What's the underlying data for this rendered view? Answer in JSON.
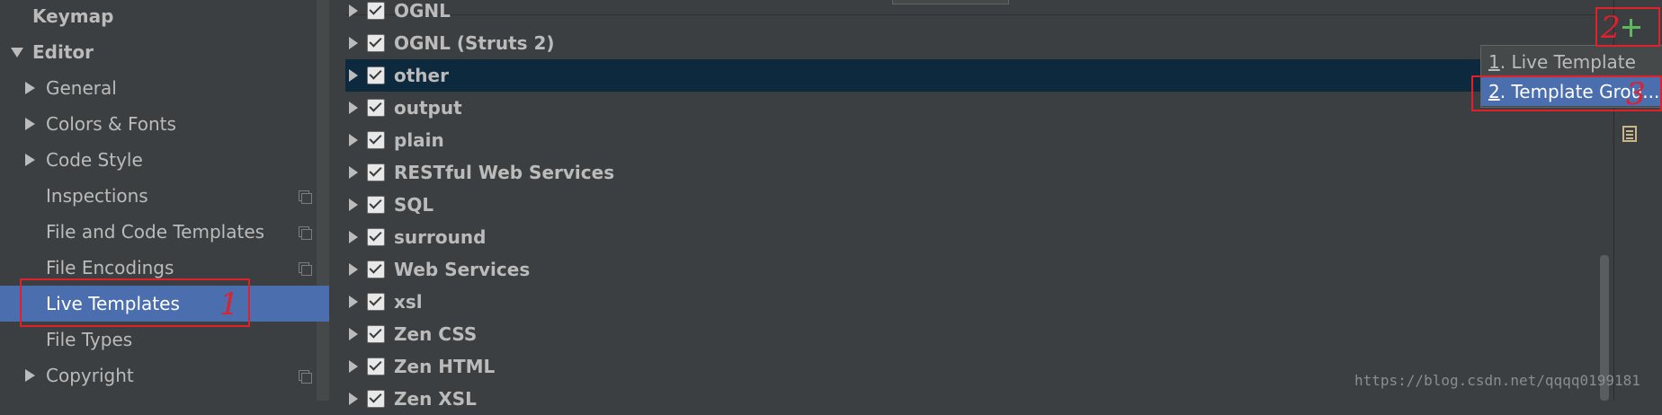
{
  "sidebar": {
    "items": [
      {
        "label": "Keymap",
        "bold": true,
        "arrow": "none",
        "selected": false,
        "has_copy_icon": false
      },
      {
        "label": "Editor",
        "bold": true,
        "arrow": "expanded",
        "selected": false,
        "has_copy_icon": false
      },
      {
        "label": "General",
        "bold": false,
        "arrow": "collapsed",
        "selected": false,
        "has_copy_icon": false
      },
      {
        "label": "Colors & Fonts",
        "bold": false,
        "arrow": "collapsed",
        "selected": false,
        "has_copy_icon": false
      },
      {
        "label": "Code Style",
        "bold": false,
        "arrow": "collapsed",
        "selected": false,
        "has_copy_icon": false
      },
      {
        "label": "Inspections",
        "bold": false,
        "arrow": "none",
        "selected": false,
        "has_copy_icon": true
      },
      {
        "label": "File and Code Templates",
        "bold": false,
        "arrow": "none",
        "selected": false,
        "has_copy_icon": true
      },
      {
        "label": "File Encodings",
        "bold": false,
        "arrow": "none",
        "selected": false,
        "has_copy_icon": true
      },
      {
        "label": "Live Templates",
        "bold": false,
        "arrow": "none",
        "selected": true,
        "has_copy_icon": false
      },
      {
        "label": "File Types",
        "bold": false,
        "arrow": "none",
        "selected": false,
        "has_copy_icon": false
      },
      {
        "label": "Copyright",
        "bold": false,
        "arrow": "collapsed",
        "selected": false,
        "has_copy_icon": true
      }
    ]
  },
  "template_groups": [
    {
      "label": "OGNL",
      "checked": true,
      "selected": false
    },
    {
      "label": "OGNL (Struts 2)",
      "checked": true,
      "selected": false
    },
    {
      "label": "other",
      "checked": true,
      "selected": true
    },
    {
      "label": "output",
      "checked": true,
      "selected": false
    },
    {
      "label": "plain",
      "checked": true,
      "selected": false
    },
    {
      "label": "RESTful Web Services",
      "checked": true,
      "selected": false
    },
    {
      "label": "SQL",
      "checked": true,
      "selected": false
    },
    {
      "label": "surround",
      "checked": true,
      "selected": false
    },
    {
      "label": "Web Services",
      "checked": true,
      "selected": false
    },
    {
      "label": "xsl",
      "checked": true,
      "selected": false
    },
    {
      "label": "Zen CSS",
      "checked": true,
      "selected": false
    },
    {
      "label": "Zen HTML",
      "checked": true,
      "selected": false
    },
    {
      "label": "Zen XSL",
      "checked": true,
      "selected": false
    }
  ],
  "toolbar": {
    "add_icon": "plus-icon",
    "doc_icon": "document-icon"
  },
  "popup_menu": {
    "items": [
      {
        "mnemonic": "1",
        "label": ". Live Template",
        "highlighted": false
      },
      {
        "mnemonic": "2",
        "label": ". Template Grou...",
        "highlighted": true
      }
    ]
  },
  "annotations": {
    "mark_1": "1",
    "mark_2": "2",
    "mark_3": "3",
    "color": "#e0202a"
  },
  "watermark": "https://blog.csdn.net/qqqq0199181",
  "colors": {
    "background": "#3c3f41",
    "selection": "#4b6eaf",
    "inactive_selection": "#0d293e",
    "add_green": "#5fb85f"
  }
}
